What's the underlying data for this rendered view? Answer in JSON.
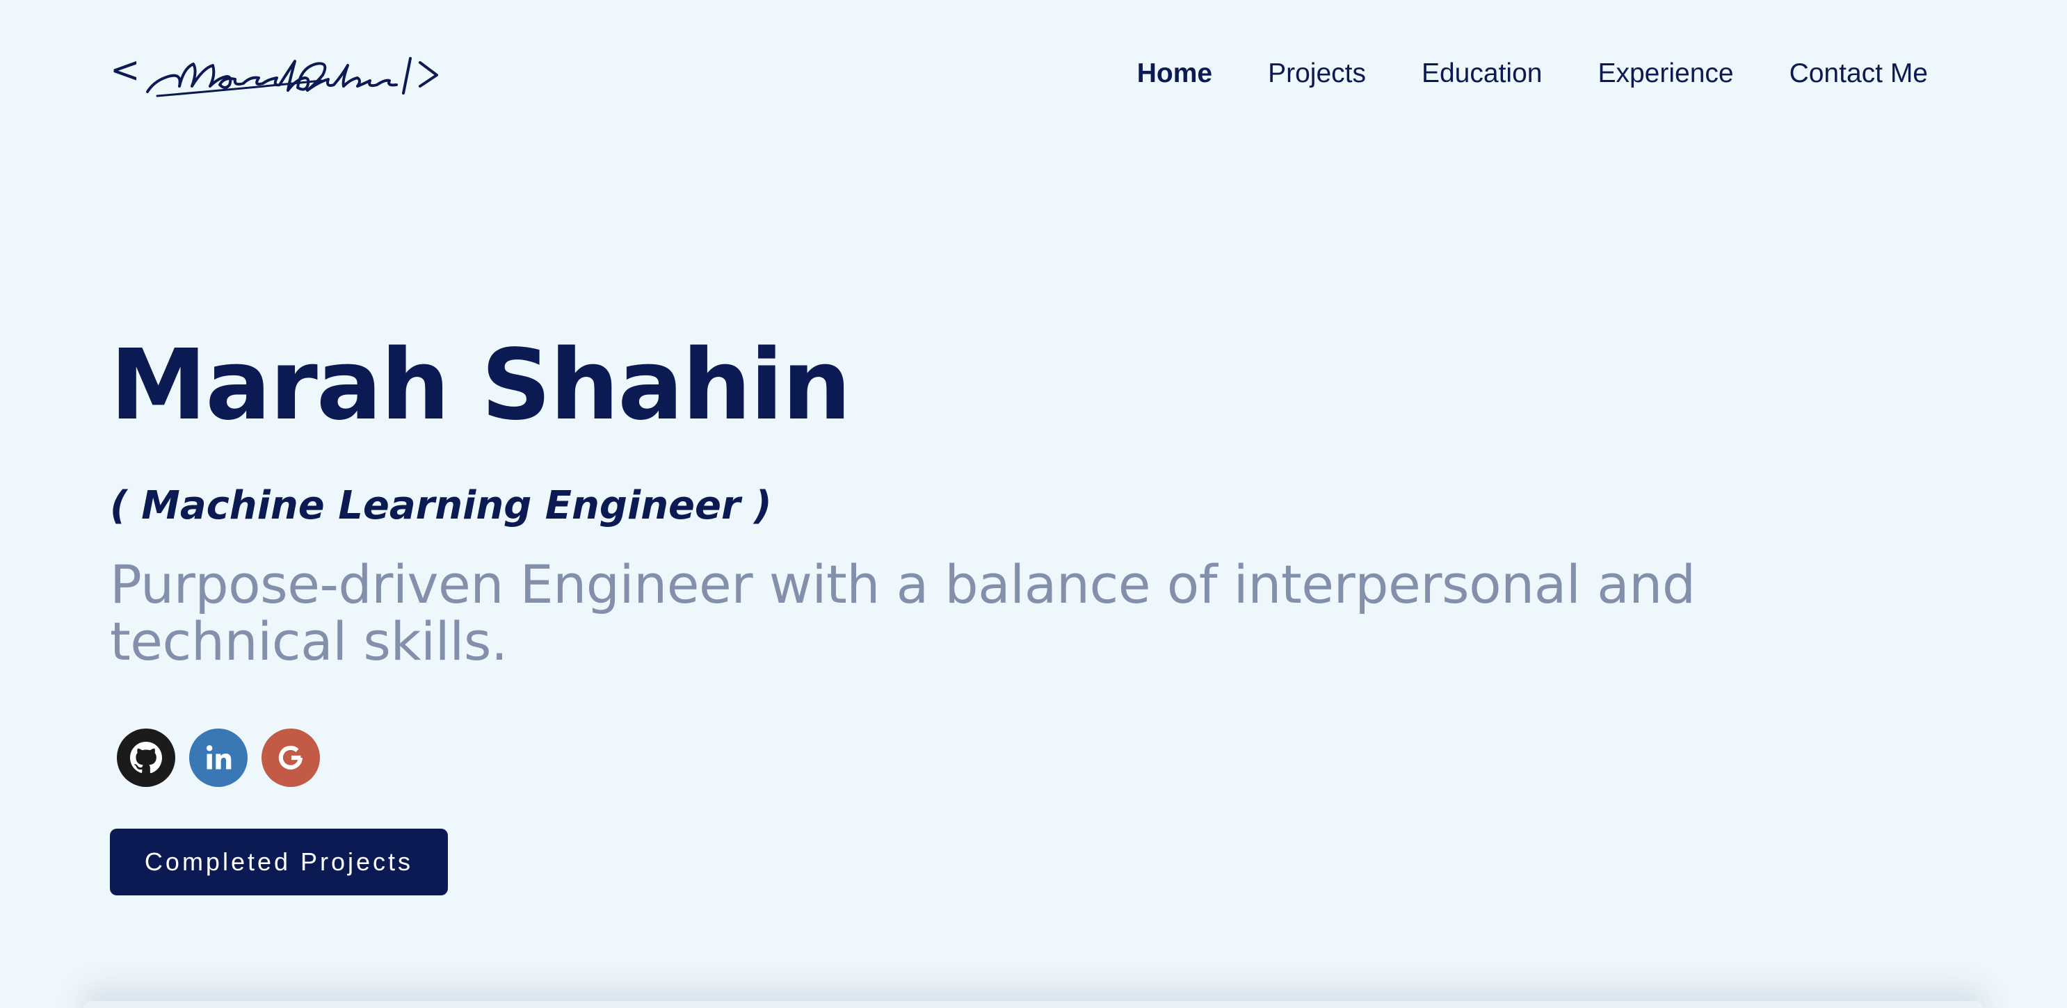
{
  "header": {
    "logo_text": "< Marah Shahin />",
    "nav": [
      {
        "label": "Home",
        "active": true
      },
      {
        "label": "Projects",
        "active": false
      },
      {
        "label": "Education",
        "active": false
      },
      {
        "label": "Experience",
        "active": false
      },
      {
        "label": "Contact Me",
        "active": false
      }
    ]
  },
  "hero": {
    "name": "Marah Shahin",
    "role": "( Machine Learning Engineer )",
    "tagline": "Purpose-driven Engineer with a balance of interpersonal and technical skills.",
    "socials": [
      {
        "icon": "github-icon",
        "color": "#1b1b1b"
      },
      {
        "icon": "linkedin-icon",
        "color": "#3a78b5"
      },
      {
        "icon": "google-icon",
        "color": "#c25a46"
      }
    ],
    "cta_label": "Completed Projects"
  },
  "colors": {
    "primary": "#0b1a52",
    "background": "#eef7fc",
    "muted_text": "#8390ab"
  }
}
